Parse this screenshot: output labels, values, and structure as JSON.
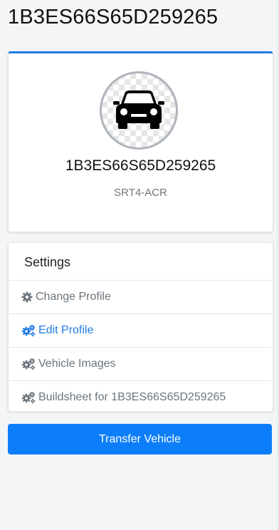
{
  "page": {
    "title": "1B3ES66S65D259265"
  },
  "vehicle": {
    "name": "1B3ES66S65D259265",
    "model": "SRT4-ACR",
    "avatar_icon": "car-icon",
    "accent_color": "#1f7be4"
  },
  "settings": {
    "header": "Settings",
    "items": [
      {
        "label": "Change Profile",
        "icon": "gear-icon",
        "active": false
      },
      {
        "label": "Edit Profile",
        "icon": "gears-icon",
        "active": true
      },
      {
        "label": "Vehicle Images",
        "icon": "gears-icon",
        "active": false
      },
      {
        "label": "Buildsheet for 1B3ES66S65D259265",
        "icon": "gears-icon",
        "active": false
      }
    ]
  },
  "actions": {
    "transfer_label": "Transfer Vehicle",
    "transfer_color": "#0d7ef9"
  }
}
